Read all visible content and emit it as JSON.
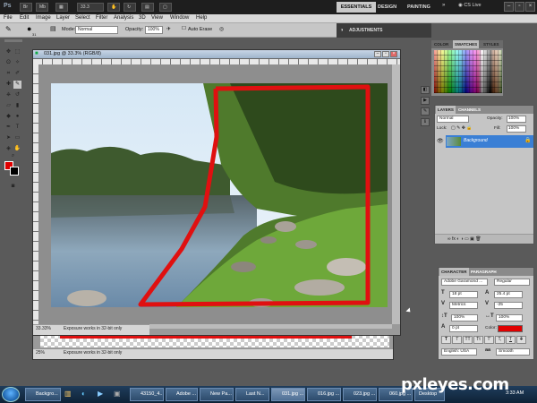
{
  "app": {
    "logo": "Ps",
    "zoom": "33.3"
  },
  "workspaces": {
    "essentials": "ESSENTIALS",
    "design": "DESIGN",
    "painting": "PAINTING",
    "more": "»",
    "cs_live": "CS Live"
  },
  "window_controls": {
    "minimize": "–",
    "restore": "▫",
    "close": "×"
  },
  "menu": [
    "File",
    "Edit",
    "Image",
    "Layer",
    "Select",
    "Filter",
    "Analysis",
    "3D",
    "View",
    "Window",
    "Help"
  ],
  "options": {
    "brush_size": "31",
    "mode_label": "Mode:",
    "mode_value": "Normal",
    "opacity_label": "Opacity:",
    "opacity_value": "100%",
    "auto_erase": "Auto Erase"
  },
  "adjustments_tab": "ADJUSTMENTS",
  "document": {
    "title": "031.jpg @ 33.3% (RGB/8)",
    "zoom": "33.33%",
    "status_message": "Exposure works in 32-bit only",
    "bg_zoom": "25%",
    "bg_status_message": "Exposure works in 32-bit only"
  },
  "color_panel": {
    "tabs": [
      "COLOR",
      "SWATCHES",
      "STYLES"
    ]
  },
  "layers_panel": {
    "tabs": [
      "LAYERS",
      "CHANNELS"
    ],
    "blend_mode": "Normal",
    "opacity_label": "Opacity:",
    "opacity_value": "100%",
    "lock_label": "Lock:",
    "fill_label": "Fill:",
    "fill_value": "100%",
    "layer_name": "Background",
    "footer_icons": "∞  fx  ◐  ◑  ▭  ▣  🗑"
  },
  "character_panel": {
    "tabs": [
      "CHARACTER",
      "PARAGRAPH"
    ],
    "font_family": "Adobe Garamond ...",
    "font_style": "Regular",
    "font_size": "18 pt",
    "leading": "25.4 pt",
    "kerning": "Metrics",
    "tracking": "-25",
    "vertical_scale": "100%",
    "horizontal_scale": "100%",
    "baseline_shift": "0 pt",
    "color_label": "Color:",
    "language": "English: USA",
    "antialias": "Smooth",
    "style_buttons": [
      "T",
      "T",
      "TT",
      "Tt",
      "T'",
      "T,",
      "T",
      "T"
    ]
  },
  "taskbar": {
    "items": [
      "Backgro...",
      "43150_4...",
      "Adobe ...",
      "New Pa...",
      "Last N...",
      "031.jpg ...",
      "016.jpg ...",
      "023.jpg ...",
      "060.jpg ...",
      "Desktop"
    ],
    "clock": "3:33 AM"
  },
  "watermark": "pxleyes.com",
  "colors": {
    "foreground": "#e00000",
    "background": "#000000",
    "selection_stroke": "#e01010",
    "layer_selected": "#3a7fd5"
  }
}
